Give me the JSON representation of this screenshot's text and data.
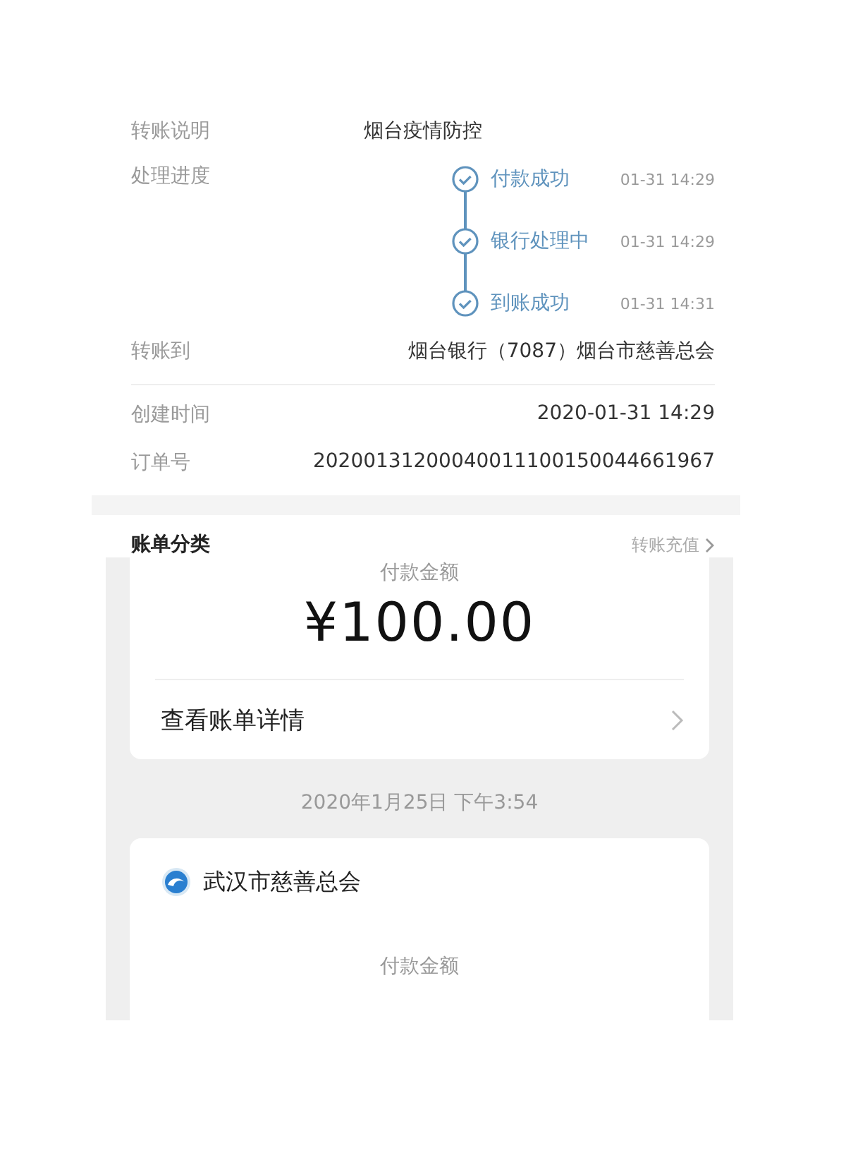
{
  "transfer_detail": {
    "note": {
      "label": "转账说明",
      "value": "烟台疫情防控"
    },
    "progress": {
      "label": "处理进度",
      "steps": [
        {
          "name": "付款成功",
          "time": "01-31 14:29",
          "done": true
        },
        {
          "name": "银行处理中",
          "time": "01-31 14:29",
          "done": true
        },
        {
          "name": "到账成功",
          "time": "01-31 14:31",
          "done": true
        }
      ]
    },
    "payee": {
      "label": "转账到",
      "value": "烟台银行（7087）烟台市慈善总会"
    },
    "created": {
      "label": "创建时间",
      "value": "2020-01-31 14:29"
    },
    "order": {
      "label": "订单号",
      "value": "20200131200040011100150044661967"
    },
    "category": {
      "label": "账单分类",
      "value": "转账充值"
    }
  },
  "bill_list": {
    "first_bill": {
      "amount_label": "付款金额",
      "amount": "¥100.00",
      "link": "查看账单详情"
    },
    "date": "2020年1月25日 下午3:54",
    "second_bill": {
      "payee": "武汉市慈善总会",
      "amount_label": "付款金额"
    }
  }
}
